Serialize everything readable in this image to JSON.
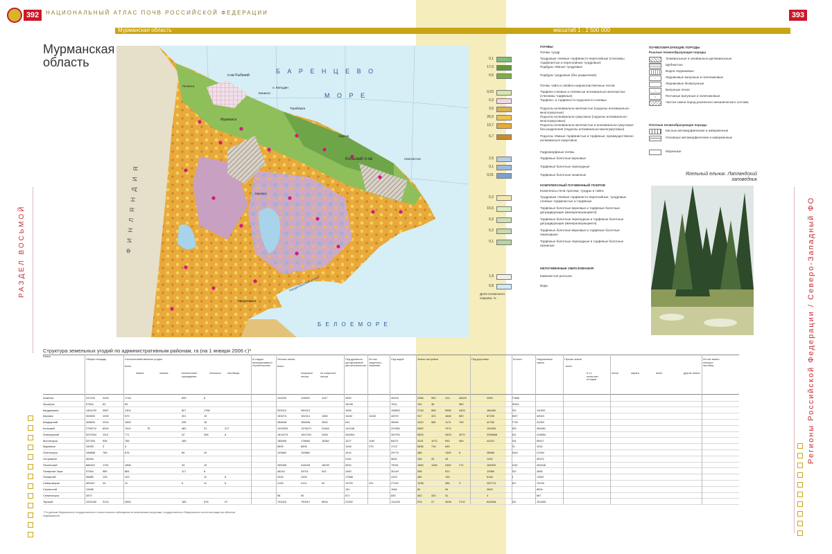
{
  "header": {
    "left_page_number": "392",
    "right_page_number": "393",
    "running_title": "НАЦИОНАЛЬНЫЙ АТЛАС ПОЧВ РОССИЙСКОЙ ФЕДЕРАЦИИ",
    "ribbon_region": "Мурманская область",
    "ribbon_scale": "масштаб 1 : 2 500 000"
  },
  "map_title": "Мурманская область",
  "section_left": "РАЗДЕЛ ВОСЬМОЙ",
  "section_right": "Регионы Российской Федерации / Северо-Западный ФО",
  "map": {
    "sea_labels": [
      "Б А Р Е Н Ц Е В О",
      "М О Р Е",
      "Б Е Л О Е   М О Р Е"
    ],
    "country_label": "Ф И Н Л Я Н Д И Я",
    "peninsula_labels": [
      "п-ов Рыбачий",
      "Кольский п-ов"
    ],
    "places": [
      "Печенга",
      "Мурманск",
      "Териберка",
      "Харлов",
      "Святой Нос",
      "Кандалакша",
      "Кировск",
      "Канинги",
      "о. Кильдин"
    ],
    "bay_label": "Кандалакшский залив"
  },
  "legend": {
    "h_soils": "ПОЧВЫ",
    "h_tundra": "Почвы тундр",
    "h_taiga": "Почвы тайги и хвойно-широколиственных лесов",
    "h_hydro": "Гидроморфные почвы",
    "h_complex": "КОМПЛЕКСНЫЙ ПОЧВЕННЫЙ ПОКРОВ",
    "h_complex2": "Комплексы почв Арктики, тундры и тайги",
    "h_nonsoil": "НЕПОЧВЕННЫЕ ОБРАЗОВАНИЯ",
    "rows": [
      {
        "val": "0,1",
        "text": "Тундровые глеевые торфянисто-перегнойные (глееземы торфянистые и перегнойные тундровые)"
      },
      {
        "val": "17,0",
        "text": "Подбуры тёмные тундровые"
      },
      {
        "val": "0,5",
        "text": "Подбуры тундровые (без разделения)"
      },
      {
        "val": "0,03",
        "text": "Торфяно-глеевые и глееватые иллювиально-железистые (глееземы торфяные)"
      },
      {
        "val": "0,2",
        "text": "Торфяно- и торфяносто-подзолисто-глеевые"
      },
      {
        "val": "3,6",
        "text": "Подзолы иллювиально-железистые (подзолы иллювиально-многогумусные)"
      },
      {
        "val": "26,5",
        "text": "Подзолы иллювиально-гумусовые (подзолы иллювиально-многогумусовые)"
      },
      {
        "val": "10,7",
        "text": "Подзолы иллювиально-железистые и иллювиально-гумусовые без разделения (подзолы иллювиально-малогумусовые)"
      },
      {
        "val": "5,7",
        "text": "Подзолы тёмные торфянистые и торфяные, преимущественно иллювиально-гумусовые"
      },
      {
        "val": "2,5",
        "text": "Торфяные болотные верховые"
      },
      {
        "val": "0,1",
        "text": "Торфяные болотные переходные"
      },
      {
        "val": "0,01",
        "text": "Торфяные болотные низинные"
      },
      {
        "val": "0,2",
        "text": "Тундровые глеевые торфянисто-перегнойные, тундровые глеевые торфянистые и торфяные"
      },
      {
        "val": "15,5",
        "text": "Торфяные болотные верховые и торфяные болотные деградирующие (минерализующиеся)"
      },
      {
        "val": "0,2",
        "text": "Торфяные болотные переходные и торфяные болотные деградирующие (минерализующиеся)"
      },
      {
        "val": "0,2",
        "text": "Торфяные болотные верховые и торфяные болотные переходные"
      },
      {
        "val": "0,1",
        "text": "Торфяные болотные переходные в торфяные болотные низинные"
      },
      {
        "val": "1,8",
        "text": "Каменистые россыпи"
      },
      {
        "val": "0,8",
        "text": "Вода"
      }
    ],
    "area_note": "Доля почвенного покрова, %"
  },
  "legend2": {
    "h_rocks": "ПОЧВООБРАЗУЮЩИЕ ПОРОДЫ",
    "h_loose": "Рыхлые почвообразующие породы",
    "h_dense": "Плотные почвообразующие породы",
    "rows": [
      "Элювиальные и элювиально-делювиальные",
      "Щебнистые",
      "Водно-ледниковые",
      "Ледниковые валунные и галечниковые",
      "Ледниковые безвалунные",
      "Валунные пески",
      "Песчаные валунные и галечниковые",
      "Частая смена пород различного механического состава",
      "Кислые метаморфические и изверженные",
      "Основные метаморфические и изверженные",
      "Моренные"
    ]
  },
  "photo_caption": "Ягельный ельник. Лапландский заповедник",
  "table": {
    "title": "Структура земельных угодий по административным районам, га (на 1 января 2006 г.)*",
    "headers": [
      "Район",
      "Общая площадь",
      "Сельскохозяйственные угодья",
      "всего",
      "пашня",
      "залежь",
      "многолетние насаждения",
      "сенокосы",
      "пастбища",
      "В стадии мелиоративного строительства",
      "Лесные земли",
      "всего",
      "покрытые лесом",
      "не покрытые лесом",
      "Под древесно-кустарниковой растительностью",
      "Из них защитного значения",
      "Под водой",
      "Земли застройки",
      "Под дорогами",
      "Болота",
      "Нарушенные земли",
      "Прочие земли",
      "всего",
      "в т.ч. полигоны отходов",
      "пески",
      "овраги",
      "иные",
      "другие земли",
      "Из них земли оленьих пастбищ"
    ],
    "rows": [
      [
        "Апатиты",
        "247100",
        "2416",
        "1718",
        "",
        "690",
        "8",
        "",
        "120200",
        "119053",
        "1147",
        "2900",
        "",
        "40103",
        "2066",
        "952",
        "414",
        "48320",
        "2383",
        "27868"
      ],
      [
        "Заозерск",
        "57604",
        "63",
        "63",
        "",
        "",
        "",
        "",
        "",
        "",
        "",
        "16196",
        "",
        "7614",
        "102",
        "48",
        "",
        "980",
        "",
        "28301"
      ],
      [
        "Кандалакша",
        "1461220",
        "3987",
        "1304",
        "",
        "827",
        "1786",
        "",
        "930010",
        "930010",
        "",
        "1908",
        "",
        "198802",
        "2748",
        "565",
        "5989",
        "4303",
        "184460",
        "202",
        "111592"
      ],
      [
        "Кировск",
        "263500",
        "1039",
        "879",
        "",
        "201",
        "19",
        "",
        "153274",
        "151914",
        "1360",
        "11152",
        "11152",
        "42570",
        "917",
        "423",
        "1646",
        "800",
        "87235",
        "4557",
        "40523"
      ],
      [
        "Ковдорский",
        "406600",
        "2204",
        "1853",
        "",
        "335",
        "16",
        "",
        "284638",
        "284606",
        "2832",
        "641",
        "",
        "35540",
        "1020",
        "585",
        "1174",
        "795",
        "42785",
        "2739",
        "31053"
      ],
      [
        "Кольский",
        "2708712",
        "8349",
        "7614",
        "75",
        "482",
        "21",
        "217",
        "1402825",
        "1378471",
        "24464",
        "141238",
        "",
        "221581",
        "8362",
        "",
        "7974",
        "",
        "190284",
        "928",
        "284481"
      ],
      [
        "Ловозерский",
        "5297644",
        "1113",
        "771",
        "",
        "22",
        "308",
        "8",
        "1814275",
        "1811760",
        "2455",
        "346354",
        "",
        "309751",
        "5825",
        "",
        "3403",
        "3070",
        "3398668",
        "541",
        "415654"
      ],
      [
        "Мончегорск",
        "337454",
        "938",
        "785",
        "",
        "185",
        "",
        "",
        "185055",
        "178660",
        "16362",
        "1227",
        "1190",
        "84071",
        "3191",
        "1072",
        "993",
        "554",
        "42310",
        "204",
        "59417"
      ],
      [
        "Мурманск",
        "15095",
        "3",
        "3",
        "",
        "",
        "",
        "",
        "6505",
        "6505",
        "",
        "1248",
        "275",
        "1713",
        "5836",
        "716",
        "645",
        "",
        "",
        "23",
        "1031"
      ],
      [
        "Оленегорск",
        "196868",
        "785",
        "676",
        "",
        "89",
        "20",
        "",
        "109882",
        "109882",
        "",
        "1014",
        "",
        "29779",
        "486",
        "",
        "1350",
        "8",
        "28588",
        "8344",
        "21934"
      ],
      [
        "Островной",
        "46284",
        "",
        "",
        "",
        "",
        "",
        "",
        "",
        "",
        "",
        "2162",
        "",
        "5834",
        "246",
        "25",
        "49",
        "",
        "1432",
        "",
        "39372"
      ],
      [
        "Печенгский",
        "886322",
        "1781",
        "1658",
        "",
        "33",
        "15",
        "",
        "335285",
        "318246",
        "18039",
        "5254",
        "",
        "75931",
        "1850",
        "1280",
        "2450",
        "272",
        "163000",
        "1126",
        "283448"
      ],
      [
        "Полярные Зори",
        "97464",
        "989",
        "884",
        "",
        "117",
        "8",
        "",
        "46244",
        "45701",
        "543",
        "1400",
        "",
        "30149",
        "288",
        "",
        "923",
        "",
        "12986",
        "202",
        "4565"
      ],
      [
        "Полярный",
        "35885",
        "128",
        "103",
        "",
        "",
        "11",
        "6",
        "2426",
        "2426",
        "",
        "17588",
        "",
        "2323",
        "480",
        "",
        "135",
        "",
        "5148",
        "3",
        "12667"
      ],
      [
        "Североморск",
        "381647",
        "34",
        "11",
        "",
        "6",
        "11",
        "6",
        "2153",
        "2121",
        "32",
        "13700",
        "231",
        "27102",
        "1238",
        "",
        "355",
        "3",
        "251774",
        "157",
        "75133"
      ],
      [
        "Скалистый",
        "13485",
        "",
        "",
        "",
        "",
        "",
        "",
        "",
        "",
        "",
        "151",
        "",
        "1064",
        "82",
        "",
        "94",
        "",
        "2600",
        "",
        "8504"
      ],
      [
        "Снежногорск",
        "2870",
        "",
        "",
        "",
        "",
        "",
        "",
        "58",
        "50",
        "",
        "871",
        "",
        "835",
        "462",
        "333",
        "41",
        "",
        "4",
        "",
        "687"
      ],
      [
        "Терский",
        "1931000",
        "3124",
        "2554",
        "",
        "185",
        "578",
        "97",
        "792416",
        "790912",
        "8634",
        "21592",
        "",
        "114228",
        "576",
        "27",
        "3008",
        "2702",
        "643308",
        "532",
        "151855"
      ]
    ]
  },
  "footnote": "* По данным Федерального государственного статистического наблюдения за земельными ресурсами, государственного Федерального агентства кадастра объектов недвижимости."
}
